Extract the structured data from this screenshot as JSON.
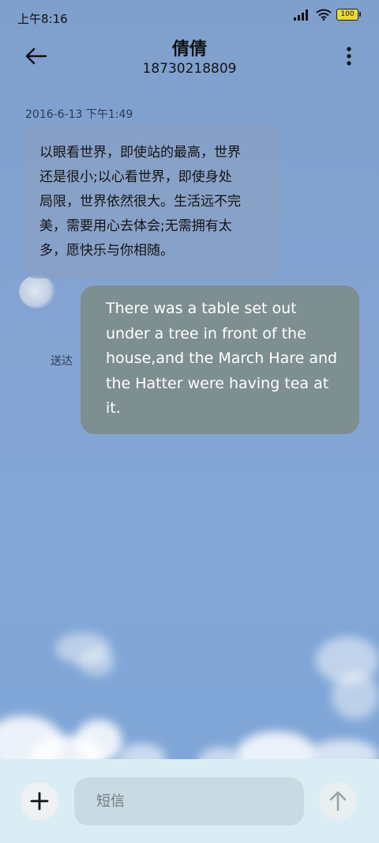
{
  "status_bar": {
    "time": "上午8:16",
    "battery": "100"
  },
  "header": {
    "contact_name": "倩倩",
    "phone_number": "18730218809",
    "back_icon": "arrow-left-icon",
    "menu_icon": "more-vertical-icon"
  },
  "conversation": {
    "timestamp": "2016-6-13 下午1:49",
    "messages": [
      {
        "direction": "incoming",
        "lines": [
          "以眼看世界，即使站的最高，世界",
          "还是很小;以心看世界，即使身处",
          "局限，世界依然很大。生活远不完",
          "美，需要用心去体会;无需拥有太",
          "多，愿快乐与你相随。"
        ]
      },
      {
        "direction": "outgoing",
        "lines": [
          "There was a table set out",
          "under a tree in front of the",
          "house,and the March Hare and",
          "the Hatter were having tea at",
          "it."
        ],
        "status": "送达"
      }
    ]
  },
  "composer": {
    "placeholder": "短信",
    "add_icon": "plus-icon",
    "send_icon": "arrow-up-icon"
  },
  "colors": {
    "background": "#82a5d4",
    "incoming_bubble": "#8aa0c4",
    "outgoing_bubble": "#7e8f91",
    "composer_bg": "#dbedf4"
  }
}
